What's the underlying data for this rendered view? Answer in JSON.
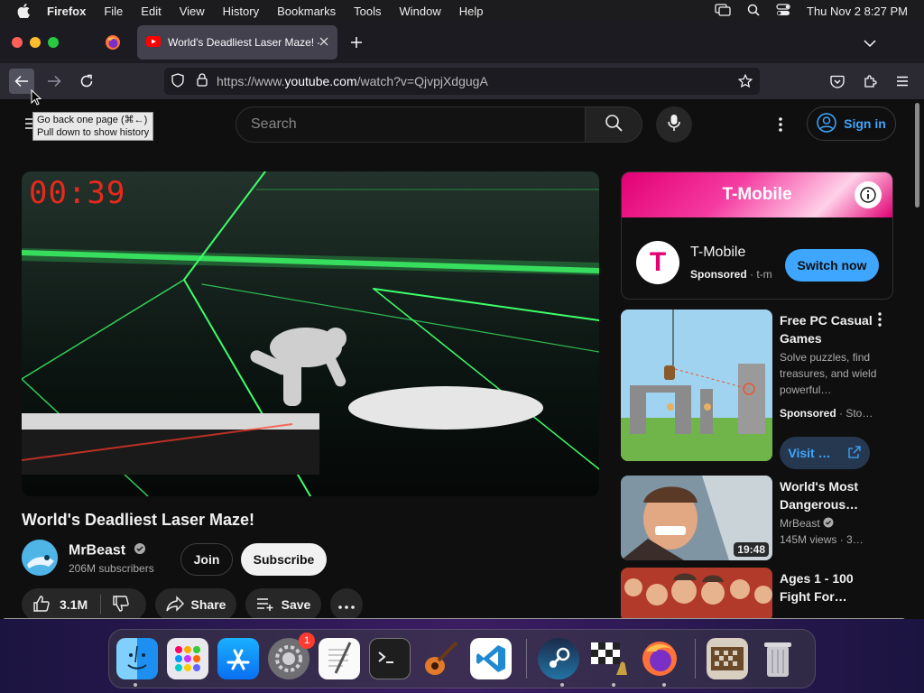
{
  "menubar": {
    "app": "Firefox",
    "items": [
      "File",
      "Edit",
      "View",
      "History",
      "Bookmarks",
      "Tools",
      "Window",
      "Help"
    ],
    "clock": "Thu Nov 2  8:27 PM"
  },
  "tab": {
    "title": "World's Deadliest Laser Maze! -"
  },
  "toolbar": {
    "url_prefix": "https://www.",
    "url_host": "youtube.com",
    "url_path": "/watch?v=QjvpjXdgugA"
  },
  "tooltip": {
    "line1": "Go back one page (⌘←)",
    "line2": "Pull down to show history"
  },
  "youtube": {
    "search_placeholder": "Search",
    "signin_label": "Sign in",
    "video": {
      "timer": "00:39",
      "title": "World's Deadliest Laser Maze!",
      "channel": "MrBeast",
      "subscribers": "206M subscribers",
      "join_label": "Join",
      "subscribe_label": "Subscribe",
      "likes": "3.1M",
      "share_label": "Share",
      "save_label": "Save"
    },
    "ad": {
      "banner": "T-Mobile",
      "name": "T-Mobile",
      "sponsored": "Sponsored",
      "domain": "· t-m",
      "cta": "Switch now"
    },
    "recommendations": [
      {
        "title": "Free PC Casual Games",
        "desc": "Solve puzzles, find treasures, and wield powerful…",
        "sponsored": "Sponsored",
        "source": "· Sto…",
        "cta": "Visit …"
      },
      {
        "title": "World's Most Dangerous…",
        "channel": "MrBeast",
        "stats": "145M views  · 3…",
        "duration": "19:48"
      },
      {
        "title": "Ages 1 - 100 Fight For…"
      }
    ]
  },
  "dock": {
    "settings_badge": "1"
  }
}
